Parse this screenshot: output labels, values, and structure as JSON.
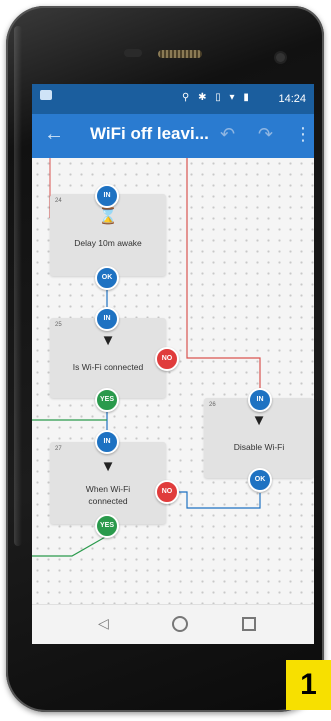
{
  "status_bar": {
    "icons": "⚲ ✱ ▯ ▾ ▮",
    "time": "14:24"
  },
  "toolbar": {
    "back_icon": "arrow-left-icon",
    "title": "WiFi off leavi...",
    "undo_icon": "undo-icon",
    "redo_icon": "redo-icon",
    "more_icon": "more-vert-icon"
  },
  "blocks": [
    {
      "num": "24",
      "label": "Delay 10m awake",
      "icon": "hourglass-icon",
      "in": "IN",
      "out": "OK"
    },
    {
      "num": "25",
      "label": "Is Wi-Fi connected",
      "icon": "wifi-icon",
      "in": "IN",
      "yes": "YES",
      "no": "NO"
    },
    {
      "num": "26",
      "label": "Disable Wi-Fi",
      "icon": "wifi-icon",
      "in": "IN",
      "out": "OK"
    },
    {
      "num": "27",
      "label_line1": "When Wi-Fi",
      "label_line2": "connected",
      "icon": "wifi-icon",
      "in": "IN",
      "yes": "YES",
      "no": "NO"
    }
  ],
  "fab": {
    "label": "+"
  },
  "page_marker": "1",
  "colors": {
    "status_bar": "#1b5e9e",
    "toolbar": "#2a7bd0",
    "port_blue": "#1e72c2",
    "port_red": "#e03c3c",
    "port_green": "#2a9a4c"
  }
}
